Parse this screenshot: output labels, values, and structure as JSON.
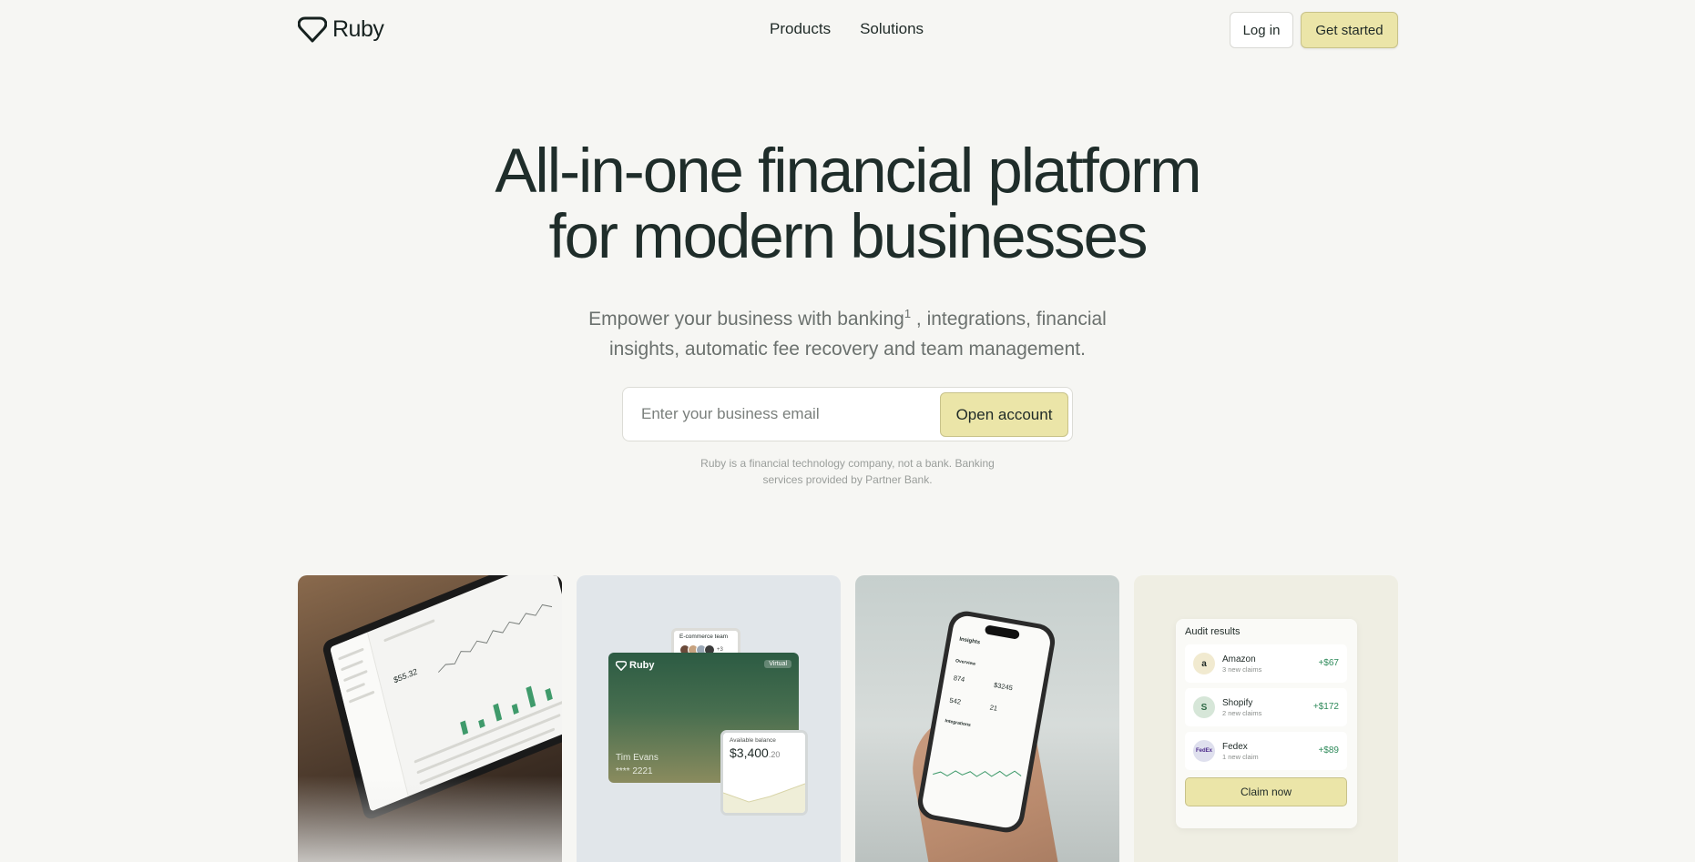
{
  "brand": {
    "name": "Ruby"
  },
  "nav": {
    "links": [
      "Products",
      "Solutions"
    ],
    "login_label": "Log in",
    "start_label": "Get started"
  },
  "hero": {
    "title_line1": "All-in-one financial platform",
    "title_line2": "for modern businesses",
    "sub_line1_pre": "Empower your business with banking",
    "sub_footnote": "1",
    "sub_line1_post": " , integrations, financial",
    "sub_line2": "insights, automatic fee recovery and team management.",
    "email_placeholder": "Enter your business email",
    "open_label": "Open account",
    "disclaimer_line1": "Ruby is a financial technology company, not a bank. Banking",
    "disclaimer_line2": "services provided by Partner Bank."
  },
  "cards": {
    "laptop": {
      "balance": "$55.32"
    },
    "card": {
      "team_label": "E-commerce team",
      "team_more": "+3",
      "brand": "Ruby",
      "virtual_label": "Virtual",
      "holder": "Tim Evans",
      "number": "**** 2221",
      "balance_label": "Available balance",
      "balance_main": "$3,400",
      "balance_cents": ".20"
    },
    "phone": {
      "title": "Insights",
      "overview": "Overview",
      "values": [
        "874",
        "$3245",
        "542",
        "21"
      ],
      "integrations": "Integrations"
    },
    "audit": {
      "title": "Audit results",
      "rows": [
        {
          "icon": "a",
          "name": "Amazon",
          "sub": "3 new claims",
          "amount": "+$67",
          "color": "#f1ead0"
        },
        {
          "icon": "S",
          "name": "Shopify",
          "sub": "2 new claims",
          "amount": "+$172",
          "color": "#d6e6d8"
        },
        {
          "icon": "FedEx",
          "name": "Fedex",
          "sub": "1 new claim",
          "amount": "+$89",
          "color": "#dfe0ee"
        }
      ],
      "claim_label": "Claim now"
    }
  },
  "colors": {
    "accent": "#ebe5a8",
    "background": "#f6f6f3",
    "positive": "#2e8a5a"
  }
}
